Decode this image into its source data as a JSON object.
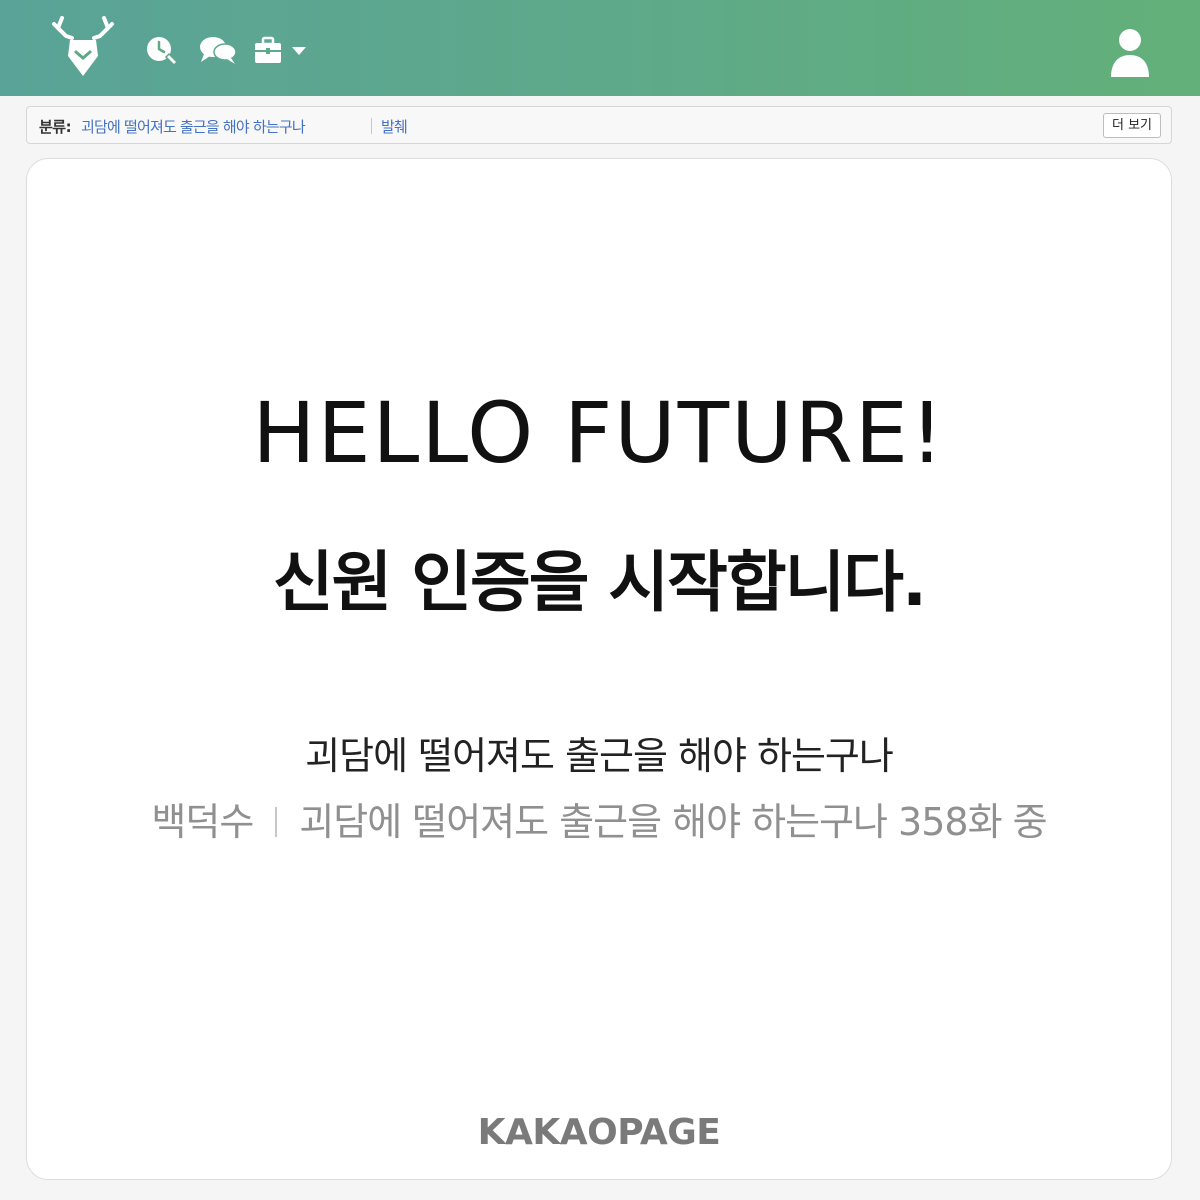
{
  "header": {
    "logo_icon": "deer-shield-logo-icon",
    "icons": [
      "history-edit-icon",
      "chat-bubbles-icon",
      "briefcase-icon",
      "caret-down-icon"
    ],
    "user_icon": "user-profile-icon",
    "colors": {
      "gradient_start": "#5aa398",
      "gradient_end": "#63b07a"
    }
  },
  "category": {
    "label": "분류:",
    "links": [
      "괴담에 떨어져도 출근을 해야 하는구나",
      "발췌"
    ],
    "more_button": "더 보기",
    "link_color": "#4472c4"
  },
  "card": {
    "headline": "HELLO FUTURE!",
    "subhead": "신원 인증을 시작합니다.",
    "series_title": "괴담에 떨어져도 출근을 해야 하는구나",
    "meta": {
      "author": "백덕수",
      "series_episode": "괴담에 떨어져도 출근을 해야 하는구나 358화 중"
    },
    "brand": "KAKAOPAGE"
  }
}
